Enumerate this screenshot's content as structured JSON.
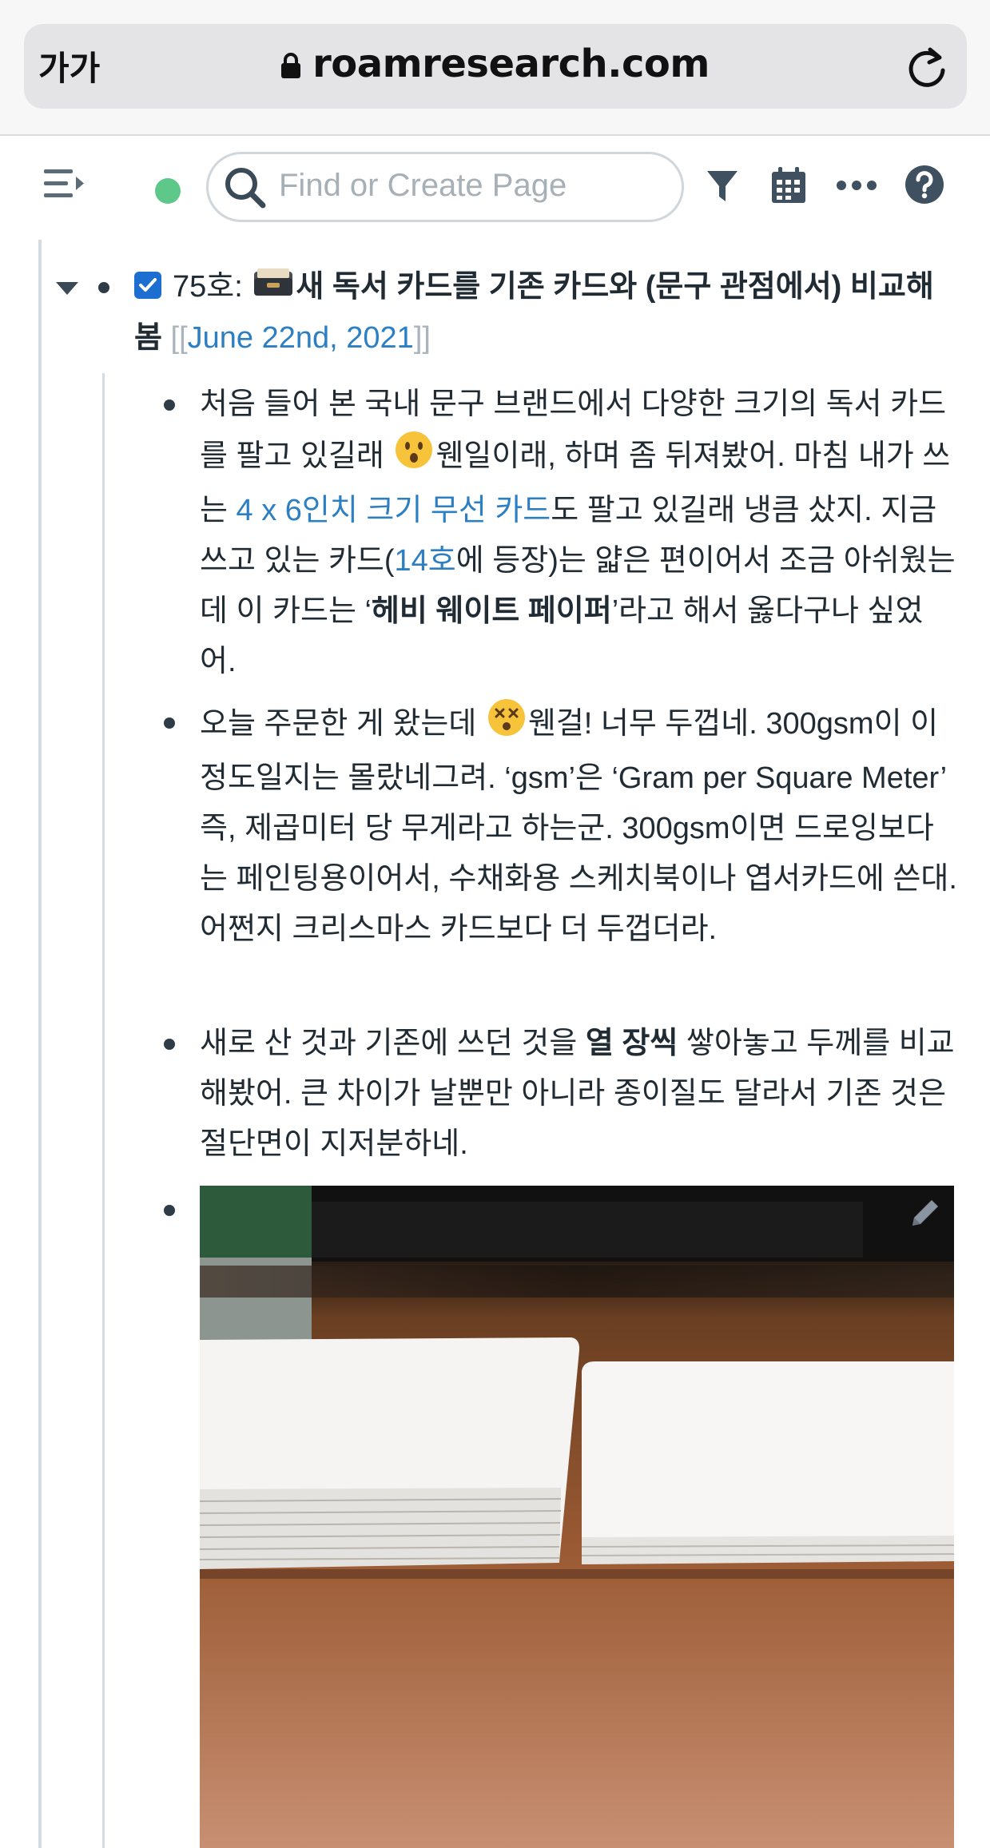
{
  "browser": {
    "text_size_button": "가가",
    "url": "roamresearch.com"
  },
  "toolbar": {
    "search_placeholder": "Find or Create Page"
  },
  "page": {
    "title_prefix": "75호:",
    "title_main": "새 독서 카드를 기존 카드와 (문구 관점에서) 비교해 봄",
    "title_link_open": "[[",
    "title_link": "June 22nd, 2021",
    "title_link_close": "]]",
    "blocks": [
      {
        "t1": "처음 들어 본 국내 문구 브랜드에서 다양한 크기의 독서 카드를 팔고 있길래 ",
        "t2": "웬일이래, 하며 좀 뒤져봤어. 마침 내가 쓰는 ",
        "link1": "4 x 6인치 크기 무선 카드",
        "t3": "도 팔고 있길래 냉큼 샀지. 지금 쓰고 있는 카드(",
        "link2": "14호",
        "t4": "에 등장)는 얇은 편이어서 조금 아쉬웠는데 이 카드는 ‘",
        "bold": "헤비 웨이트 페이퍼",
        "t5": "’라고 해서 옳다구나 싶었어."
      },
      {
        "t1": "오늘 주문한 게 왔는데 ",
        "t2": "웬걸! 너무 두껍네. 300gsm이 이 정도일지는 몰랐네그려. ‘gsm’은 ‘Gram per Square Meter’ 즉, 제곱미터 당 무게라고 하는군. 300gsm이면 드로잉보다는 페인팅용이어서, 수채화용 스케치북이나 엽서카드에 쓴대. 어쩐지 크리스마스 카드보다 더 두껍더라."
      },
      {
        "t1": "새로 산 것과 기존에 쓰던 것을 ",
        "bold": "열 장씩",
        "t2": " 쌓아놓고 두께를 비교해봤어. 큰 차이가 날뿐만 아니라 종이질도 달라서 기존 것은 절단면이 지저분하네."
      }
    ]
  },
  "icons": {
    "emoji1": "hushed-face",
    "emoji2": "dizzy-face",
    "title_emoji": "card-file-box"
  },
  "colors": {
    "link": "#2c7fc2",
    "checkbox": "#1c6fd1",
    "status": "#5ec88a"
  }
}
